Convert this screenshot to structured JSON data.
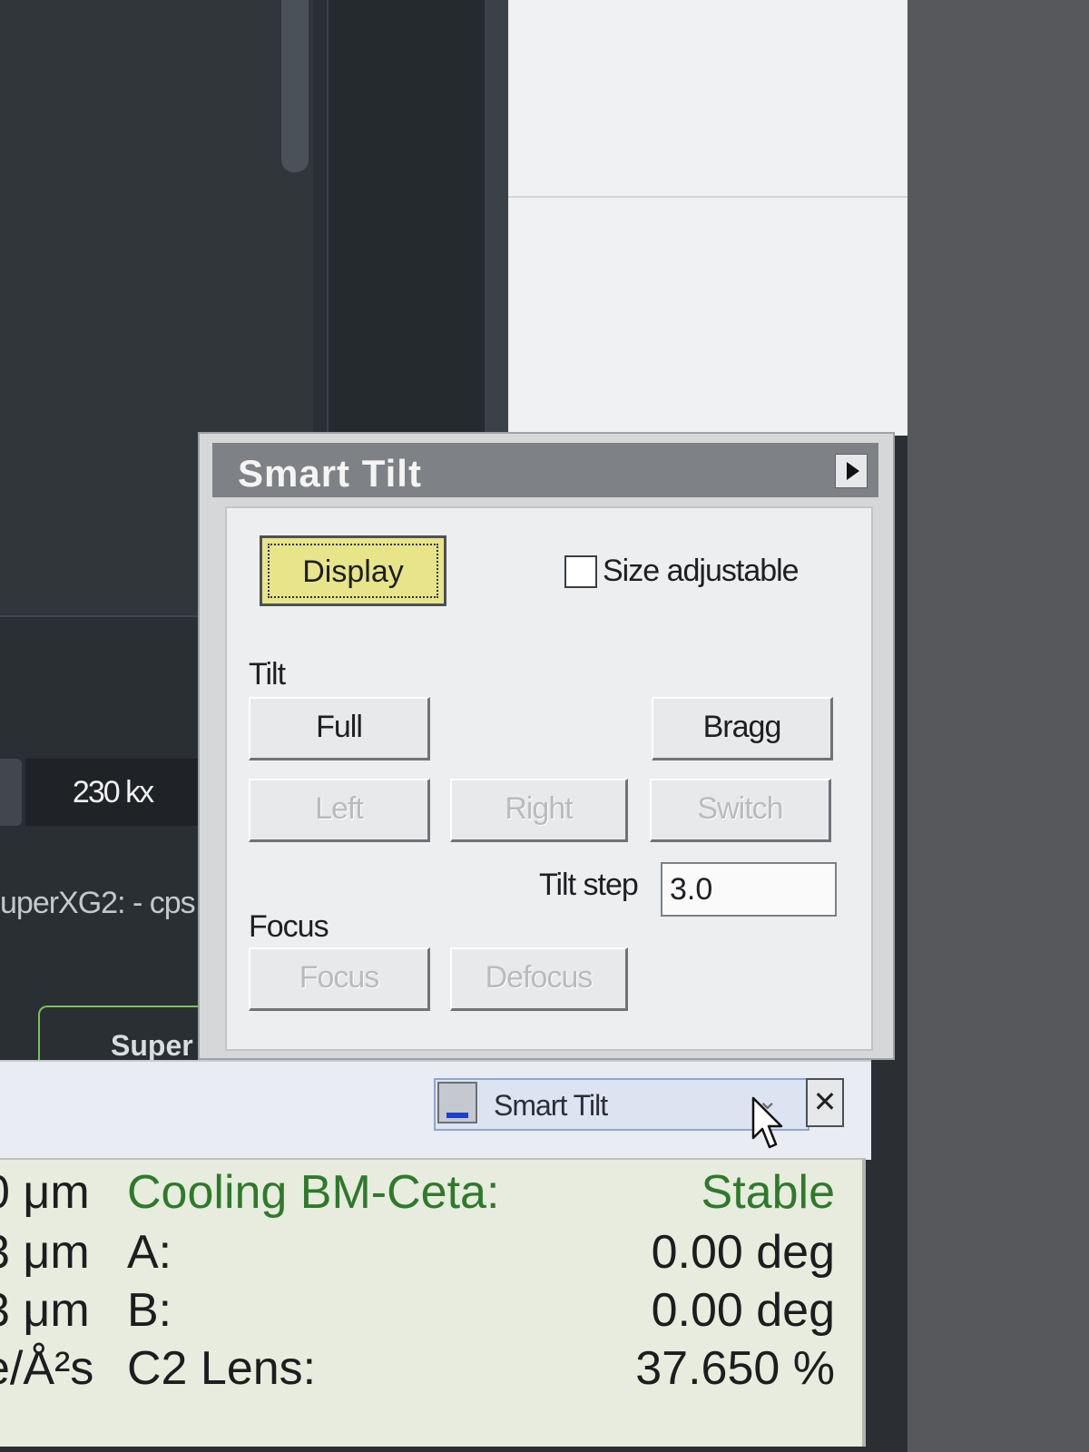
{
  "background": {
    "magnification": "230 kx",
    "detector_status": "uperXG2: - cps",
    "tab_label": "Super"
  },
  "dialog": {
    "title": "Smart Tilt",
    "display_button": "Display",
    "size_adjustable_label": "Size adjustable",
    "size_adjustable_checked": false,
    "tilt_group_label": "Tilt",
    "full_button": "Full",
    "bragg_button": "Bragg",
    "left_button": "Left",
    "right_button": "Right",
    "switch_button": "Switch",
    "tilt_step_label": "Tilt step",
    "tilt_step_value": "3.0",
    "focus_group_label": "Focus",
    "focus_button": "Focus",
    "defocus_button": "Defocus"
  },
  "taskbar": {
    "window_label": "Smart Tilt",
    "close_symbol": "✕"
  },
  "status": {
    "rows": [
      {
        "left": "0 μm",
        "label": "Cooling BM-Ceta:",
        "value": "Stable"
      },
      {
        "left": "3 μm",
        "label": "A:",
        "value": "0.00 deg"
      },
      {
        "left": "3 μm",
        "label": "B:",
        "value": "0.00 deg"
      },
      {
        "left": "e/Å²s",
        "label": "C2 Lens:",
        "value": "37.650 %"
      }
    ]
  },
  "colors": {
    "status_green": "#2e7a2a",
    "display_button_bg": "#e7e48a",
    "tab_outline": "#77c556"
  }
}
